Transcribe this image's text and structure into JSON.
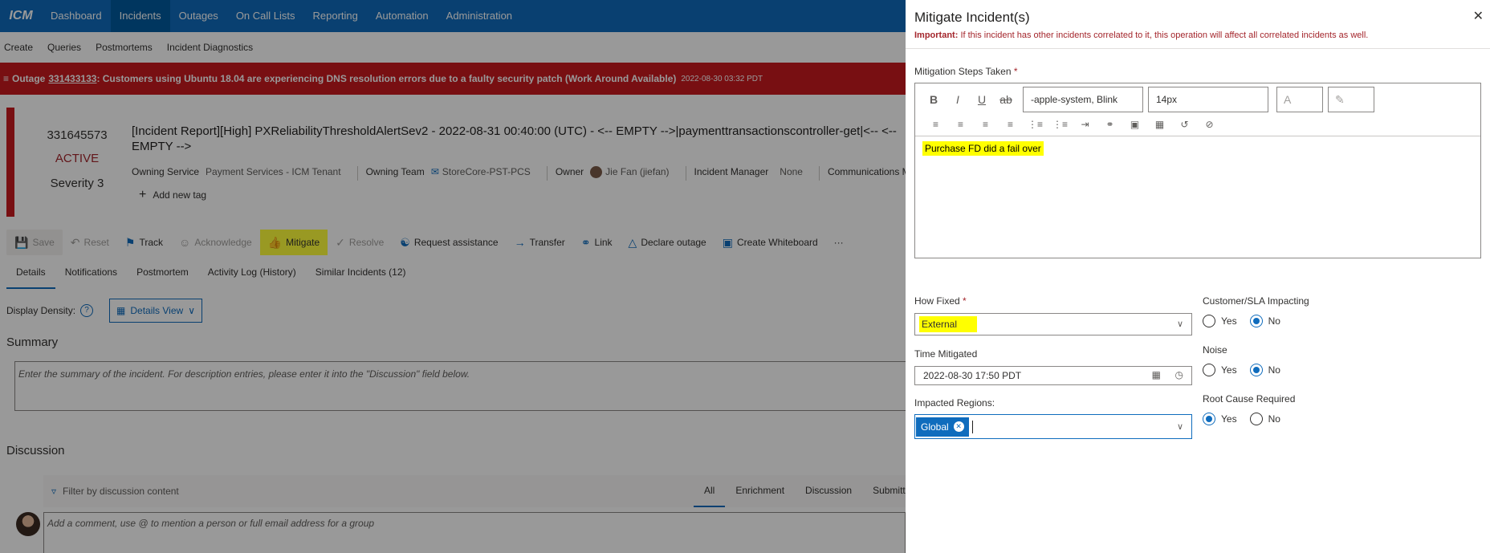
{
  "app": {
    "logo": "ICM"
  },
  "topnav": {
    "items": [
      "Dashboard",
      "Incidents",
      "Outages",
      "On Call Lists",
      "Reporting",
      "Automation",
      "Administration"
    ],
    "active": "Incidents"
  },
  "subnav": {
    "items": [
      "Create",
      "Queries",
      "Postmortems",
      "Incident Diagnostics"
    ]
  },
  "outage": {
    "label": "Outage",
    "id": "331433133",
    "text": ": Customers using Ubuntu 18.04 are experiencing DNS resolution errors due to a faulty security patch (Work Around Available)",
    "timestamp": "2022-08-30 03:32 PDT",
    "color": "#c8191e"
  },
  "incident": {
    "id": "331645573",
    "state": "ACTIVE",
    "severity": "Severity 3",
    "title": "[Incident Report][High] PXReliabilityThresholdAlertSev2 - 2022-08-31 00:40:00 (UTC) - <-- EMPTY -->|paymenttransactionscontroller-get|<-- <-- EMPTY -->",
    "owning_service_label": "Owning Service",
    "owning_service": "Payment Services - ICM Tenant",
    "owning_team_label": "Owning Team",
    "owning_team": "StoreCore-PST-PCS",
    "owner_label": "Owner",
    "owner": "Jie Fan (jiefan)",
    "manager_label": "Incident Manager",
    "manager": "None",
    "comms_label": "Communications Ma",
    "add_tag": "Add new tag"
  },
  "toolbar": {
    "save": "Save",
    "reset": "Reset",
    "track": "Track",
    "acknowledge": "Acknowledge",
    "mitigate": "Mitigate",
    "resolve": "Resolve",
    "request_assistance": "Request assistance",
    "transfer": "Transfer",
    "link": "Link",
    "declare_outage": "Declare outage",
    "create_whiteboard": "Create Whiteboard",
    "more": "···"
  },
  "tabs": [
    "Details",
    "Notifications",
    "Postmortem",
    "Activity Log (History)",
    "Similar Incidents (12)"
  ],
  "density": {
    "label": "Display Density:",
    "view": "Details View"
  },
  "summary": {
    "heading": "Summary",
    "placeholder": "Enter the summary of the incident. For description entries, please enter it into the \"Discussion\" field below."
  },
  "discussion": {
    "heading": "Discussion",
    "filter_placeholder": "Filter by discussion content",
    "tabs": [
      "All",
      "Enrichment",
      "Discussion",
      "Submitte"
    ],
    "comment_placeholder": "Add a comment, use @ to mention a person or full email address for a group"
  },
  "panel": {
    "title": "Mitigate Incident(s)",
    "important_label": "Important:",
    "important_text": " If this incident has other incidents correlated to it, this operation will affect all correlated incidents as well.",
    "steps_label": "Mitigation Steps Taken",
    "required_mark": "*",
    "font_family": "-apple-system, Blink",
    "font_size": "14px",
    "steps_content": "Purchase FD did a fail over",
    "how_fixed_label": "How Fixed",
    "how_fixed_value": "External",
    "time_label": "Time Mitigated",
    "time_value": "2022-08-30 17:50 PDT",
    "regions_label": "Impacted Regions:",
    "region_pill": "Global",
    "customer_label": "Customer/SLA Impacting",
    "noise_label": "Noise",
    "rootcause_label": "Root Cause Required",
    "yes": "Yes",
    "no": "No",
    "customer_selected": "No",
    "noise_selected": "No",
    "rootcause_selected": "Yes"
  }
}
